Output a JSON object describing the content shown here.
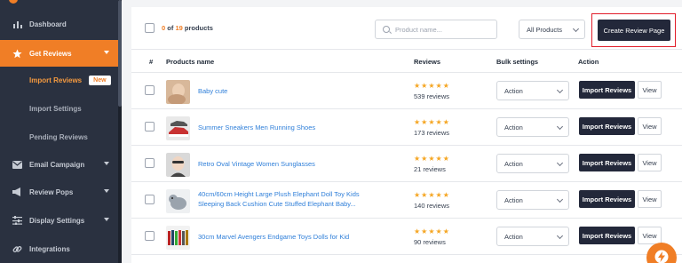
{
  "sidebar": {
    "items": [
      {
        "label": "Dashboard",
        "icon": "bar-chart-icon"
      },
      {
        "label": "Get Reviews",
        "icon": "star-icon",
        "active": true
      },
      {
        "label": "Email Campaign",
        "icon": "email-icon"
      },
      {
        "label": "Review Pops",
        "icon": "megaphone-icon"
      },
      {
        "label": "Display Settings",
        "icon": "sliders-icon"
      },
      {
        "label": "Integrations",
        "icon": "link-icon"
      }
    ],
    "subitems": [
      {
        "label": "Import Reviews",
        "active": true,
        "badge": "New"
      },
      {
        "label": "Import Settings"
      },
      {
        "label": "Pending Reviews"
      }
    ]
  },
  "toolbar": {
    "count_selected": "0",
    "count_of": "of",
    "count_total": "19",
    "count_suffix": "products",
    "search_placeholder": "Product name...",
    "filter_value": "All Products",
    "create_button": "Create Review Page"
  },
  "table": {
    "headers": {
      "index": "#",
      "name": "Products name",
      "reviews": "Reviews",
      "bulk": "Bulk settings",
      "action": "Action"
    },
    "rows": [
      {
        "name": "Baby cute",
        "stars": "★★★★★",
        "reviews": "539 reviews",
        "bulk": "Action",
        "import": "Import Reviews",
        "view": "View"
      },
      {
        "name": "Summer Sneakers Men Running Shoes",
        "stars": "★★★★★",
        "reviews": "173 reviews",
        "bulk": "Action",
        "import": "Import Reviews",
        "view": "View"
      },
      {
        "name": "Retro Oval Vintage Women Sunglasses",
        "stars": "★★★★★",
        "reviews": "21 reviews",
        "bulk": "Action",
        "import": "Import Reviews",
        "view": "View"
      },
      {
        "name": "40cm/60cm Height Large Plush Elephant Doll Toy Kids",
        "name2": "Sleeping Back Cushion Cute Stuffed Elephant Baby...",
        "stars": "★★★★★",
        "reviews": "140 reviews",
        "bulk": "Action",
        "import": "Import Reviews",
        "view": "View"
      },
      {
        "name": "30cm Marvel Avengers Endgame Toys Dolls for Kid",
        "stars": "★★★★★",
        "reviews": "90 reviews",
        "bulk": "Action",
        "import": "Import Reviews",
        "view": "View"
      }
    ]
  },
  "colors": {
    "accent": "#f07e26",
    "sidebar": "#2a3140",
    "link": "#2f7fd9",
    "star": "#f5a623",
    "dark_button": "#23283a",
    "highlight": "#e11d2a"
  }
}
